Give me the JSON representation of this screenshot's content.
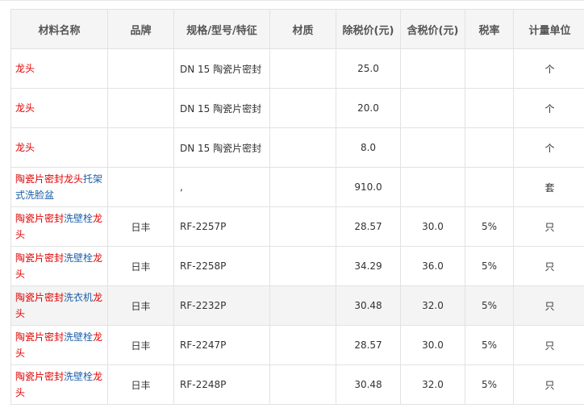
{
  "table": {
    "headers": [
      "材料名称",
      "品牌",
      "规格/型号/特征",
      "材质",
      "除税价(元)",
      "含税价(元)",
      "税率",
      "计量单位"
    ],
    "rows": [
      {
        "name": [
          {
            "text": "龙头",
            "color": "red"
          }
        ],
        "brand": "",
        "spec": "DN 15 陶瓷片密封",
        "material": "",
        "price_ex": "25.0",
        "price_in": "",
        "tax": "",
        "unit": "个"
      },
      {
        "name": [
          {
            "text": "龙头",
            "color": "red"
          }
        ],
        "brand": "",
        "spec": "DN 15 陶瓷片密封",
        "material": "",
        "price_ex": "20.0",
        "price_in": "",
        "tax": "",
        "unit": "个"
      },
      {
        "name": [
          {
            "text": "龙头",
            "color": "red"
          }
        ],
        "brand": "",
        "spec": "DN 15 陶瓷片密封",
        "material": "",
        "price_ex": "8.0",
        "price_in": "",
        "tax": "",
        "unit": "个"
      },
      {
        "name": [
          {
            "text": "陶瓷片密封",
            "color": "red"
          },
          {
            "text": "龙头",
            "color": "red"
          },
          {
            "text": "托架式洗脸盆",
            "color": "blue"
          }
        ],
        "brand": "",
        "spec": ",",
        "material": "",
        "price_ex": "910.0",
        "price_in": "",
        "tax": "",
        "unit": "套"
      },
      {
        "name": [
          {
            "text": "陶瓷片密封",
            "color": "red"
          },
          {
            "text": "洗壁栓",
            "color": "blue"
          },
          {
            "text": "龙头",
            "color": "red"
          }
        ],
        "brand": "日丰",
        "spec": "RF-2257P",
        "material": "",
        "price_ex": "28.57",
        "price_in": "30.0",
        "tax": "5%",
        "unit": "只"
      },
      {
        "name": [
          {
            "text": "陶瓷片密封",
            "color": "red"
          },
          {
            "text": "洗壁栓",
            "color": "blue"
          },
          {
            "text": "龙头",
            "color": "red"
          }
        ],
        "brand": "日丰",
        "spec": "RF-2258P",
        "material": "",
        "price_ex": "34.29",
        "price_in": "36.0",
        "tax": "5%",
        "unit": "只"
      },
      {
        "name": [
          {
            "text": "陶瓷片密封",
            "color": "red"
          },
          {
            "text": "洗衣机",
            "color": "blue"
          },
          {
            "text": "龙头",
            "color": "red"
          }
        ],
        "brand": "日丰",
        "spec": "RF-2232P",
        "material": "",
        "price_ex": "30.48",
        "price_in": "32.0",
        "tax": "5%",
        "unit": "只",
        "highlight": true
      },
      {
        "name": [
          {
            "text": "陶瓷片密封",
            "color": "red"
          },
          {
            "text": "洗壁栓",
            "color": "blue"
          },
          {
            "text": "龙头",
            "color": "red"
          }
        ],
        "brand": "日丰",
        "spec": "RF-2247P",
        "material": "",
        "price_ex": "28.57",
        "price_in": "30.0",
        "tax": "5%",
        "unit": "只"
      },
      {
        "name": [
          {
            "text": "陶瓷片密封",
            "color": "red"
          },
          {
            "text": "洗壁栓",
            "color": "blue"
          },
          {
            "text": "龙头",
            "color": "red"
          }
        ],
        "brand": "日丰",
        "spec": "RF-2248P",
        "material": "",
        "price_ex": "30.48",
        "price_in": "32.0",
        "tax": "5%",
        "unit": "只"
      }
    ]
  },
  "colors": {
    "red_text": "#e00000",
    "blue_text": "#1d5ea8",
    "header_bg": "#f5f5f5",
    "border": "#e2e2e2",
    "row_highlight": "#f4f4f4"
  }
}
